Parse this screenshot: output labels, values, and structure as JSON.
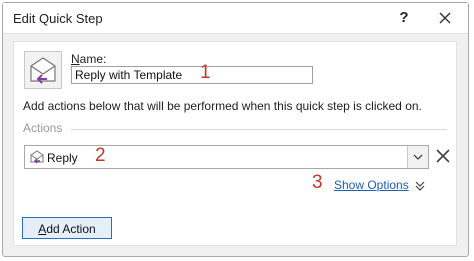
{
  "dialog": {
    "title": "Edit Quick Step",
    "help_label": "?",
    "close_icon": "close-icon"
  },
  "name_field": {
    "label_accel": "N",
    "label_rest": "ame:",
    "value": "Reply with Template"
  },
  "description": "Add actions below that will be performed when this quick step is clicked on.",
  "actions": {
    "section_label": "Actions",
    "items": [
      {
        "label": "Reply",
        "icon": "reply-envelope-icon"
      }
    ],
    "show_options_label": "Show Options",
    "add_action_accel": "A",
    "add_action_rest": "dd Action"
  },
  "callouts": [
    "1",
    "2",
    "3"
  ],
  "colors": {
    "accent_blue": "#1f5fb0",
    "callout_red": "#c0392b",
    "envelope_purple": "#7e3fa0",
    "button_border": "#2b6fb6"
  }
}
